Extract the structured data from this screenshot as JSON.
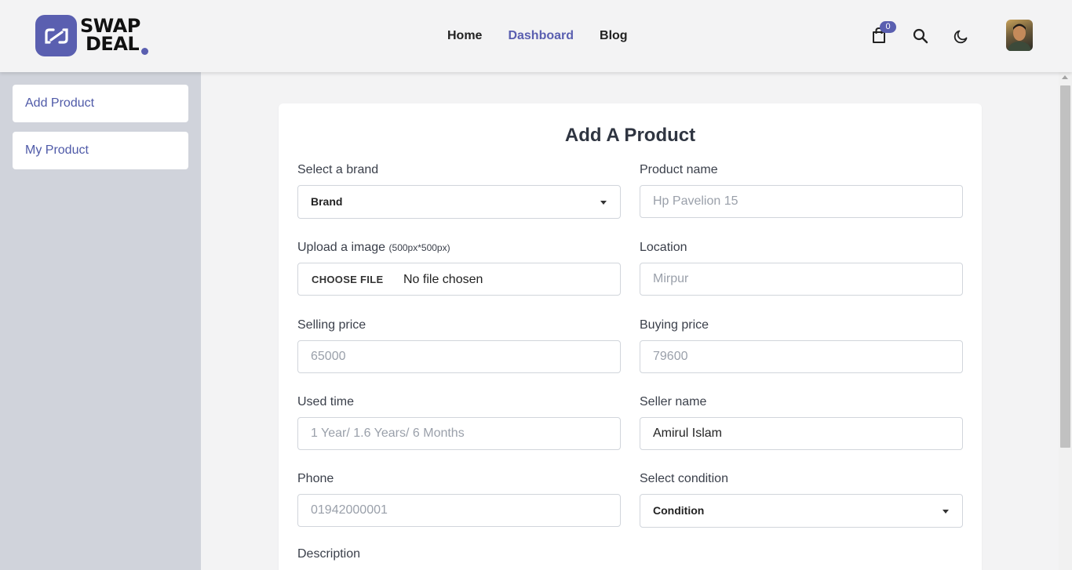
{
  "brand": {
    "line1": "SWAP",
    "line2": "DEAL"
  },
  "nav": {
    "items": [
      {
        "label": "Home"
      },
      {
        "label": "Dashboard"
      },
      {
        "label": "Blog"
      }
    ]
  },
  "header": {
    "cart_count": "0"
  },
  "sidebar": {
    "items": [
      {
        "label": "Add Product"
      },
      {
        "label": "My Product"
      }
    ]
  },
  "form": {
    "title": "Add A Product",
    "brand_label": "Select a brand",
    "brand_value": "Brand",
    "product_name_label": "Product name",
    "product_name_placeholder": "Hp Pavelion 15",
    "upload_label": "Upload a image",
    "upload_hint": "(500px*500px)",
    "file_button": "CHOOSE FILE",
    "file_status": "No file chosen",
    "location_label": "Location",
    "location_placeholder": "Mirpur",
    "selling_label": "Selling price",
    "selling_placeholder": "65000",
    "buying_label": "Buying price",
    "buying_placeholder": "79600",
    "used_label": "Used time",
    "used_placeholder": "1 Year/ 1.6 Years/ 6 Months",
    "seller_label": "Seller name",
    "seller_value": "Amirul Islam",
    "phone_label": "Phone",
    "phone_placeholder": "01942000001",
    "condition_label": "Select condition",
    "condition_value": "Condition",
    "description_label": "Description"
  },
  "colors": {
    "accent": "#5a5fb0",
    "sidebar_bg": "#d0d3db"
  },
  "icons": [
    "swap-logo-icon",
    "shopping-bag-icon",
    "search-icon",
    "moon-icon",
    "caret-down-icon"
  ]
}
